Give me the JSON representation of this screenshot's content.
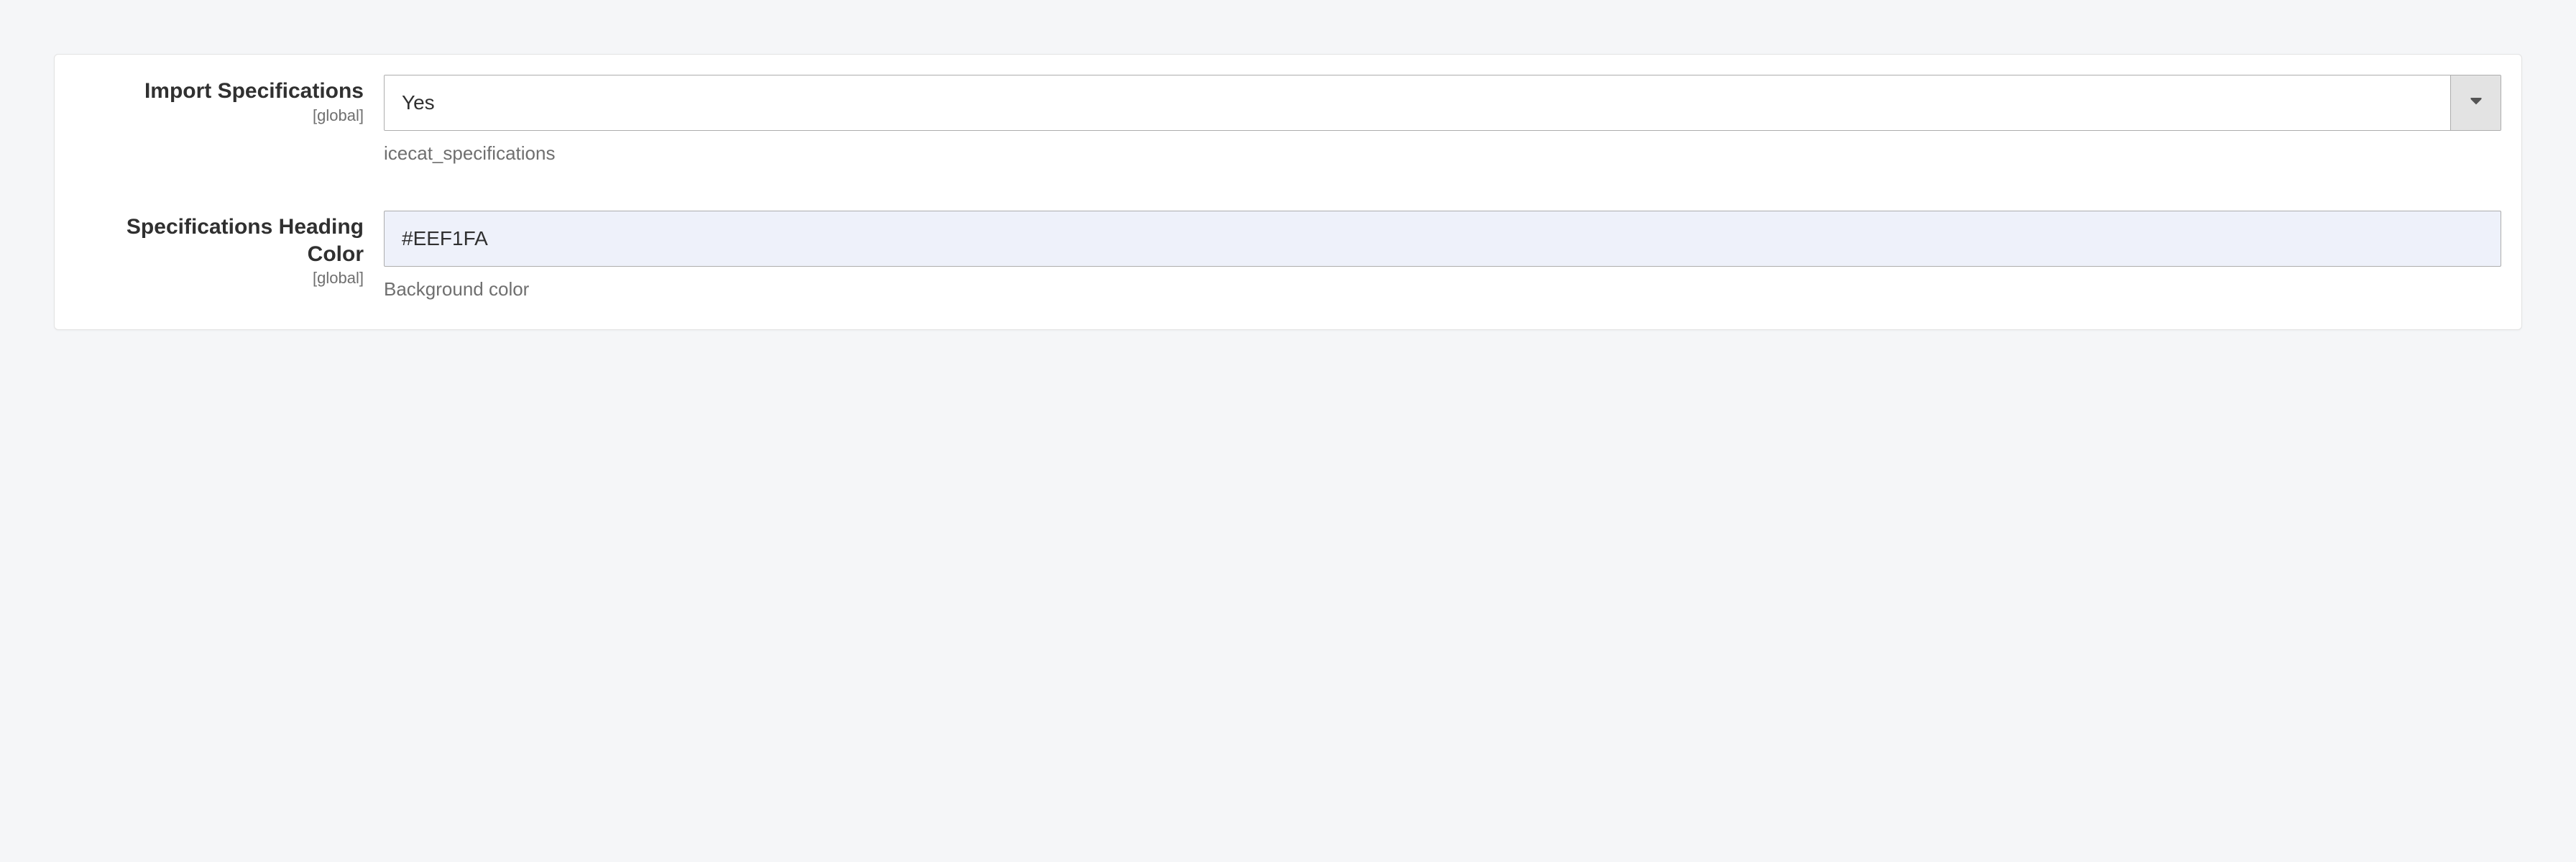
{
  "fields": {
    "import_specifications": {
      "label": "Import Specifications",
      "scope": "[global]",
      "value": "Yes",
      "note": "icecat_specifications"
    },
    "specifications_heading_color": {
      "label": "Specifications Heading Color",
      "scope": "[global]",
      "value": "#EEF1FA",
      "note": "Background color"
    }
  }
}
